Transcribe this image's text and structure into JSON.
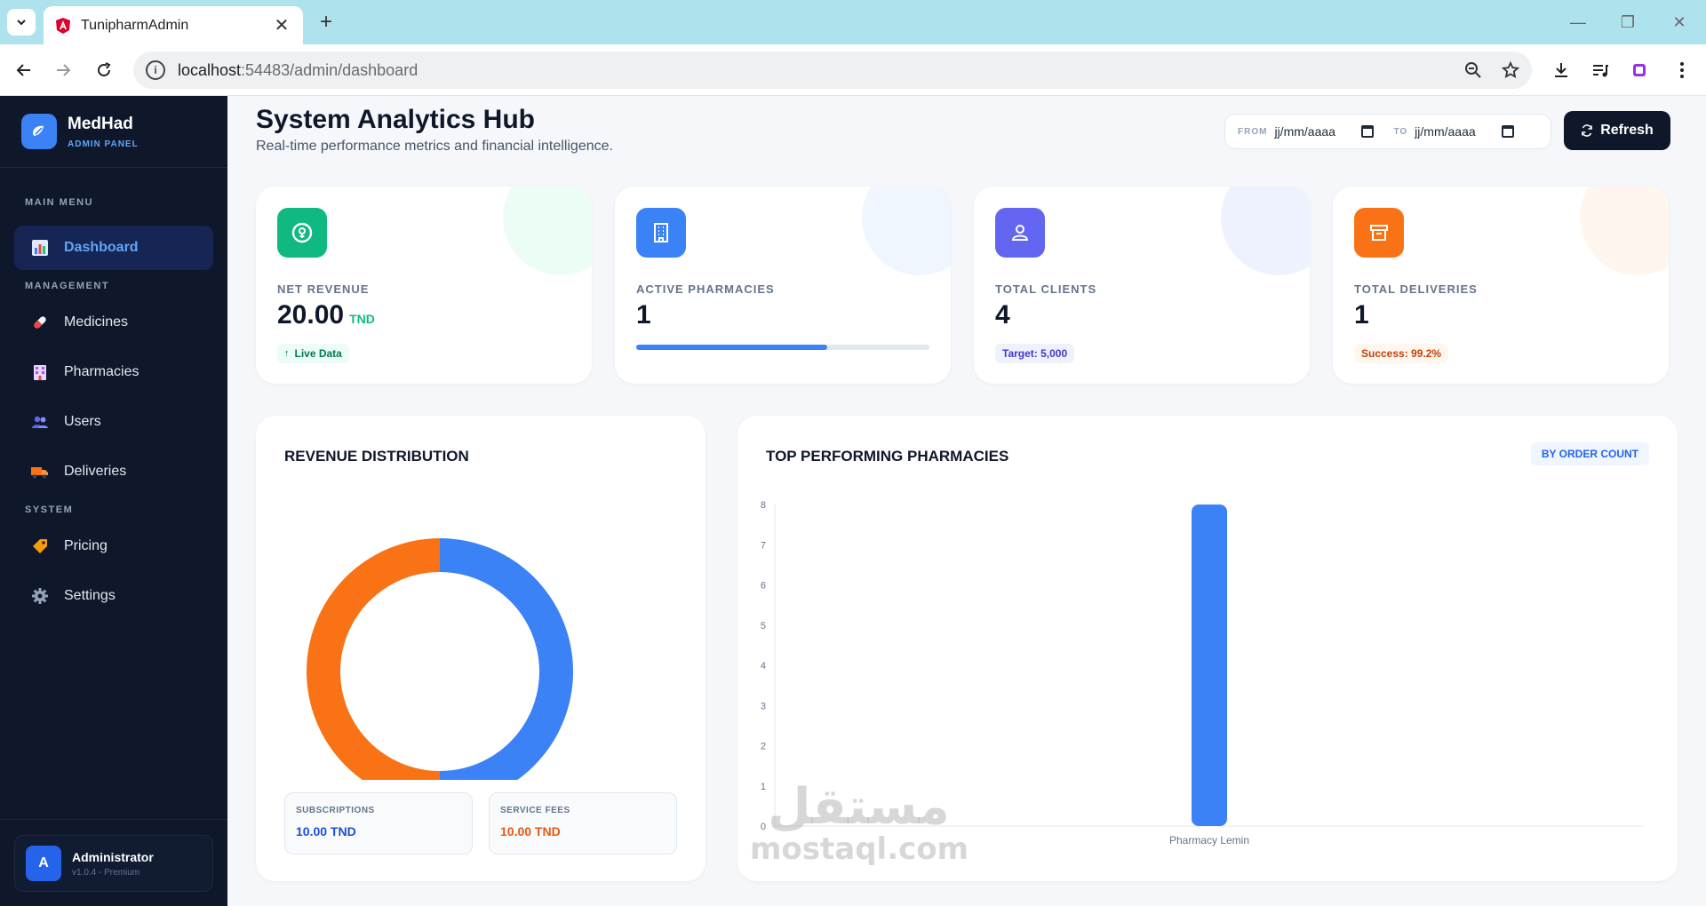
{
  "browser": {
    "tab_title": "TunipharmAdmin",
    "url_host": "localhost",
    "url_path": ":54483/admin/dashboard"
  },
  "sidebar": {
    "brand_name": "MedHad",
    "brand_sub": "ADMIN PANEL",
    "sections": {
      "main": "MAIN MENU",
      "management": "MANAGEMENT",
      "system": "SYSTEM"
    },
    "items": [
      {
        "label": "Dashboard",
        "icon": "bar-chart-icon",
        "active": true
      },
      {
        "label": "Medicines",
        "icon": "pill-icon"
      },
      {
        "label": "Pharmacies",
        "icon": "building-icon"
      },
      {
        "label": "Users",
        "icon": "users-icon"
      },
      {
        "label": "Deliveries",
        "icon": "truck-icon"
      },
      {
        "label": "Pricing",
        "icon": "tag-icon"
      },
      {
        "label": "Settings",
        "icon": "gear-icon"
      }
    ],
    "user": {
      "avatar": "A",
      "name": "Administrator",
      "version": "v1.0.4 - Premium"
    }
  },
  "header": {
    "title": "System Analytics Hub",
    "subtitle": "Real-time performance metrics and financial intelligence.",
    "from_label": "FROM",
    "to_label": "TO",
    "from_value": "jj/mm/aaaa",
    "to_value": "jj/mm/aaaa",
    "refresh_label": "Refresh"
  },
  "kpis": [
    {
      "label": "NET REVENUE",
      "value": "20.00",
      "unit": "TND",
      "badge": "Live Data",
      "color": "#10b981"
    },
    {
      "label": "ACTIVE PHARMACIES",
      "value": "1",
      "progress": 0.65,
      "color": "#3b82f6"
    },
    {
      "label": "TOTAL CLIENTS",
      "value": "4",
      "badge": "Target: 5,000",
      "color": "#6366f1"
    },
    {
      "label": "TOTAL DELIVERIES",
      "value": "1",
      "badge": "Success: 99.2%",
      "color": "#f97316"
    }
  ],
  "revenue_panel": {
    "title": "REVENUE DISTRIBUTION",
    "subscriptions_label": "SUBSCRIPTIONS",
    "subscriptions_value": "10.00 TND",
    "service_fees_label": "SERVICE FEES",
    "service_fees_value": "10.00 TND"
  },
  "pharmacy_panel": {
    "title": "TOP PERFORMING PHARMACIES",
    "tag": "BY ORDER COUNT"
  },
  "chart_data": [
    {
      "type": "pie",
      "title": "REVENUE DISTRIBUTION",
      "categories": [
        "SUBSCRIPTIONS",
        "SERVICE FEES"
      ],
      "values": [
        10,
        10
      ],
      "colors": [
        "#3b82f6",
        "#f97316"
      ]
    },
    {
      "type": "bar",
      "title": "TOP PERFORMING PHARMACIES",
      "categories": [
        "Pharmacy Lemin"
      ],
      "values": [
        8
      ],
      "ylim": [
        0,
        8
      ],
      "yticks": [
        0,
        1,
        2,
        3,
        4,
        5,
        6,
        7,
        8
      ],
      "color": "#3b82f6"
    }
  ],
  "watermark": {
    "arabic": "مستقل",
    "latin": "mostaql.com"
  }
}
